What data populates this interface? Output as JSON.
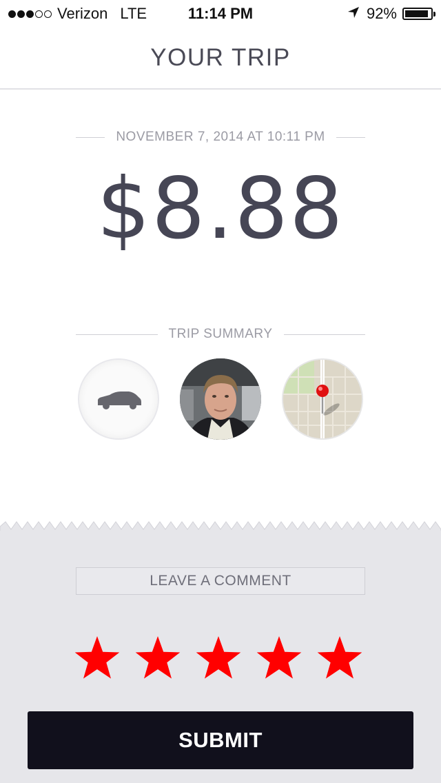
{
  "status_bar": {
    "signal_dots_filled": 3,
    "signal_dots_total": 5,
    "carrier": "Verizon",
    "network": "LTE",
    "time": "11:14 PM",
    "location_icon": "location-arrow-icon",
    "battery_percent": "92%",
    "battery_level": 0.92
  },
  "header": {
    "title": "YOUR TRIP"
  },
  "trip": {
    "datetime": "NOVEMBER 7, 2014 AT 10:11 PM",
    "fare": "$8.88",
    "summary_label": "TRIP SUMMARY",
    "summary_items": [
      {
        "icon": "car-icon"
      },
      {
        "icon": "driver-photo"
      },
      {
        "icon": "map-thumbnail"
      }
    ]
  },
  "feedback": {
    "comment_label": "LEAVE A COMMENT",
    "rating_value": 5,
    "rating_max": 5,
    "star_color": "#ff0000",
    "submit_label": "SUBMIT"
  },
  "colors": {
    "accent_dark": "#11101c",
    "text_primary": "#464655",
    "text_muted": "#9b9ba4",
    "lower_background": "#e6e6ea",
    "map_pin": "#e01010"
  }
}
